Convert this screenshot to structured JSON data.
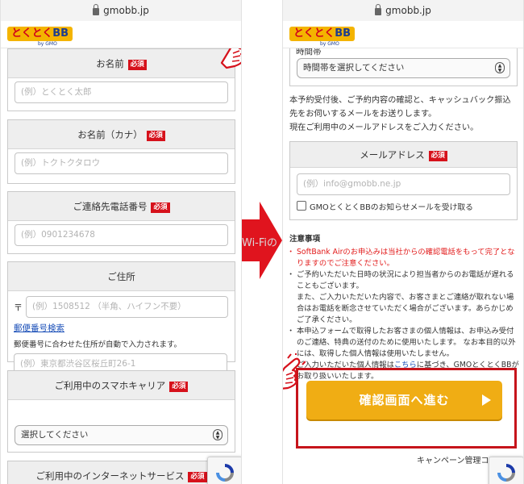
{
  "browser": {
    "url": "gmobb.jp"
  },
  "brand": {
    "logo_text_a": "とくとく",
    "logo_text_b": "BB",
    "logo_sub": "by GMO"
  },
  "left_form": {
    "name": {
      "label": "お名前",
      "required": "必須",
      "placeholder": "(例）とくとく太郎"
    },
    "kana": {
      "label": "お名前（カナ）",
      "required": "必須",
      "placeholder": "(例）トクトクタロウ"
    },
    "phone": {
      "label": "ご連絡先電話番号",
      "required": "必須",
      "placeholder": "(例）0901234678"
    },
    "address": {
      "label": "ご住所",
      "postal_mark": "〒",
      "postal_placeholder": "(例）1508512 （半角、ハイフン不要）",
      "postal_link": "郵便番号検索",
      "postal_note": "郵便番号に合わせた住所が自動で入力されます。",
      "address_placeholder": "(例）東京都渋谷区桜丘町26-1"
    },
    "carrier": {
      "label": "ご利用中のスマホキャリア",
      "required": "必須",
      "select_value": "選択してください"
    },
    "internet": {
      "label": "ご利用中のインターネットサービス",
      "required": "必須"
    }
  },
  "right_form": {
    "timeslot": {
      "label": "時間帯",
      "select_value": "時間帯を選択してください"
    },
    "intro_lines": [
      "本予約受付後、ご予約内容の確認と、キャッシュバック振込",
      "先をお伺いするメールをお送りします。",
      "現在ご利用中のメールアドレスをご入力ください。"
    ],
    "email": {
      "label": "メールアドレス",
      "required": "必須",
      "placeholder": "(例）info@gmobb.ne.jp",
      "newsletter_label": "GMOとくとくBBのお知らせメールを受け取る"
    },
    "caution": {
      "title": "注意事項",
      "red_item": "SoftBank Airのお申込みは当社からの確認電話をもって完了となりますのでご注意ください。",
      "item2_a": "ご予約いただいた日時の状況により担当者からのお電話が遅れることもございます。",
      "item2_b": "また、ご入力いただいた内容で、お客さまとご連絡が取れない場合はお電話を断念させていただく場合がございます。あらかじめご了承ください。",
      "item3": "本申込フォームで取得したお客さまの個人情報は、お申込み受付のご連絡、特典の送付のために使用いたします。 なお本目的以外には、取得した個人情報は使用いたしません。",
      "item4_pre": "ご入力いただいた個人情報は",
      "item4_link": "こちら",
      "item4_post": "に基づき、GMOとくとくBBがお取り扱いいたします。"
    },
    "confirm_button": "確認画面へ進む",
    "footer_text": "キャンペーン管理コード"
  },
  "watermark": "Wi-Fiの",
  "colors": {
    "required_red": "#d6111b",
    "button_yellow": "#f0ad14",
    "frame_red": "#c6141b",
    "arrow_red": "#e0141e"
  }
}
